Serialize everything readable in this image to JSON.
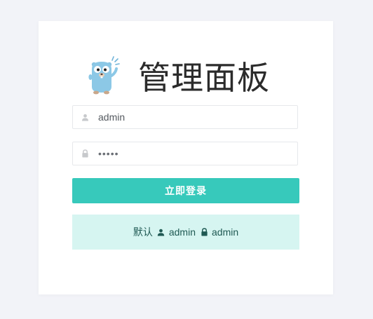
{
  "brand": {
    "title": "管理面板",
    "logo_icon": "gopher-mascot-icon"
  },
  "form": {
    "username": {
      "value": "admin",
      "icon": "user-icon"
    },
    "password": {
      "value": "•••••",
      "icon": "lock-icon"
    },
    "submit_label": "立即登录"
  },
  "hint": {
    "label": "默认",
    "username": "admin",
    "password": "admin",
    "user_icon": "user-icon",
    "lock_icon": "lock-icon"
  },
  "colors": {
    "accent": "#37c9bb",
    "hint_bg": "#d6f5f1",
    "hint_text": "#1f5953",
    "page_bg": "#f2f3f8"
  }
}
